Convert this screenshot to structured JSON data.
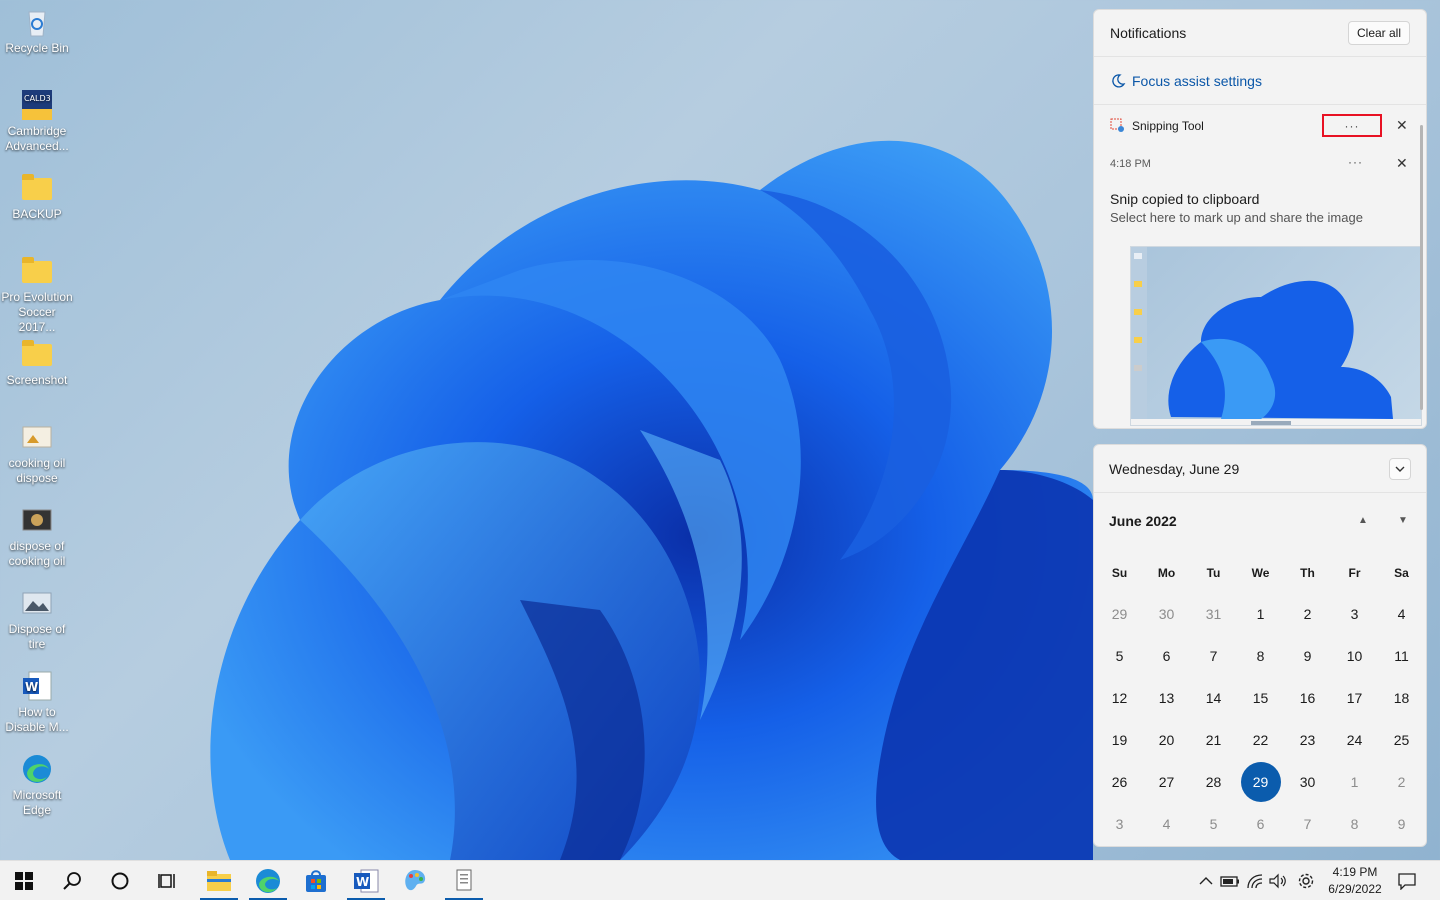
{
  "desktop": {
    "icons": [
      {
        "label": "Recycle Bin",
        "icon": "recycle-bin-icon"
      },
      {
        "label": "Cambridge Advanced...",
        "icon": "cambridge-app-icon",
        "badge": "CALD3"
      },
      {
        "label": "BACKUP",
        "icon": "folder-icon"
      },
      {
        "label": "Pro Evolution Soccer 2017...",
        "icon": "folder-icon"
      },
      {
        "label": "Screenshot",
        "icon": "folder-icon"
      },
      {
        "label": "cooking oil dispose",
        "icon": "image-file-icon"
      },
      {
        "label": "dispose of cooking oil",
        "icon": "image-file-icon"
      },
      {
        "label": "Dispose of tire",
        "icon": "image-file-icon"
      },
      {
        "label": "How to Disable M...",
        "icon": "word-document-icon"
      },
      {
        "label": "Microsoft Edge",
        "icon": "edge-icon"
      }
    ]
  },
  "notifications": {
    "title": "Notifications",
    "clear_all": "Clear all",
    "focus_assist": "Focus assist settings",
    "app": {
      "name": "Snipping Tool",
      "more": "···",
      "close": "✕"
    },
    "item": {
      "time": "4:18 PM",
      "more": "···",
      "close": "✕",
      "title": "Snip copied to clipboard",
      "subtitle": "Select here to mark up and share the image"
    }
  },
  "calendar": {
    "date_header": "Wednesday, June 29",
    "collapse": "⌄",
    "month_label": "June 2022",
    "up": "▲",
    "down": "▼",
    "weekdays": [
      "Su",
      "Mo",
      "Tu",
      "We",
      "Th",
      "Fr",
      "Sa"
    ],
    "weeks": [
      [
        "29",
        "30",
        "31",
        "1",
        "2",
        "3",
        "4"
      ],
      [
        "5",
        "6",
        "7",
        "8",
        "9",
        "10",
        "11"
      ],
      [
        "12",
        "13",
        "14",
        "15",
        "16",
        "17",
        "18"
      ],
      [
        "19",
        "20",
        "21",
        "22",
        "23",
        "24",
        "25"
      ],
      [
        "26",
        "27",
        "28",
        "29",
        "30",
        "1",
        "2"
      ],
      [
        "3",
        "4",
        "5",
        "6",
        "7",
        "8",
        "9"
      ]
    ],
    "selected_week": 4,
    "selected_day_index": 3
  },
  "taskbar": {
    "items": [
      "start-icon",
      "search-icon",
      "cortana-icon",
      "task-view-icon",
      "file-explorer-icon",
      "edge-icon",
      "store-icon",
      "word-icon",
      "paint-icon",
      "snipping-tool-icon"
    ],
    "clock_time": "4:19 PM",
    "clock_date": "6/29/2022",
    "accent": "#0b5cad"
  }
}
